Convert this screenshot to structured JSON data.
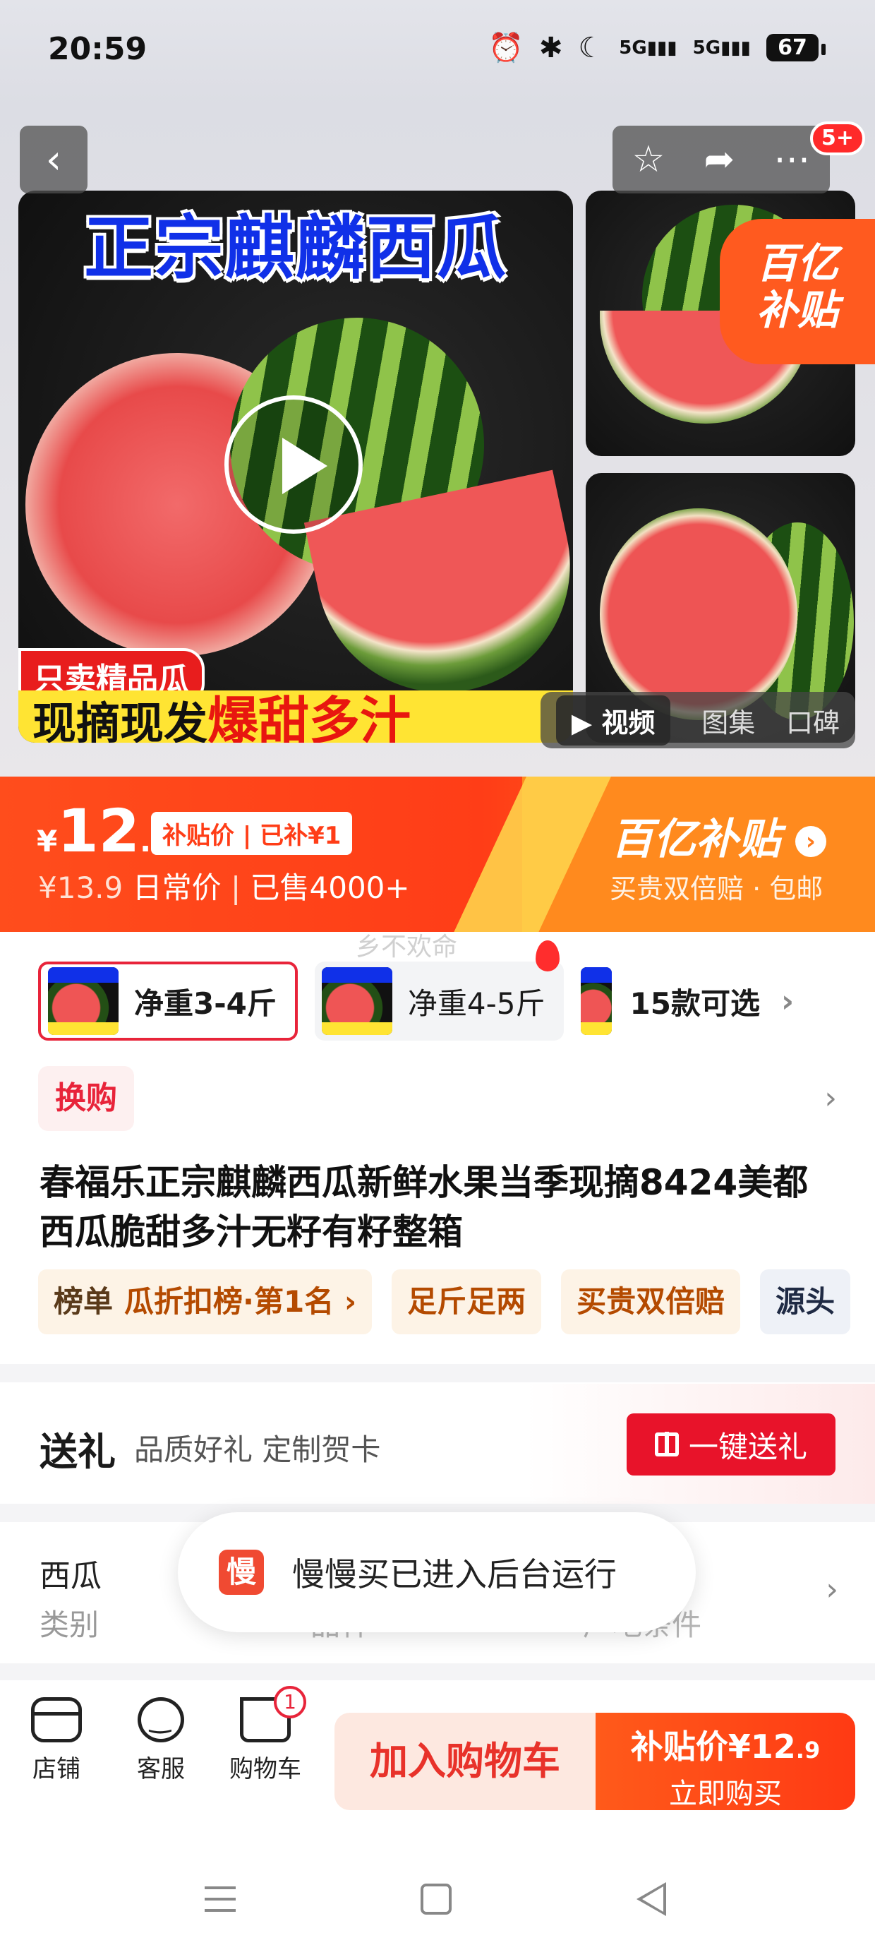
{
  "status_bar": {
    "time": "20:59",
    "network_1": "5G",
    "network_2": "5G",
    "battery": "67",
    "icons": [
      "alarm-icon",
      "bluetooth-icon",
      "moon-icon",
      "signal-icon",
      "signal-icon",
      "battery-icon"
    ]
  },
  "header": {
    "back_icon": "chevron-left-icon",
    "favorite_icon": "star-icon",
    "share_icon": "share-icon",
    "more_icon": "more-dots-icon",
    "message_badge": "5+"
  },
  "gallery": {
    "main_title": "正宗麒麟西瓜",
    "red_tag": "只卖精品瓜",
    "banner_left": "现摘现发",
    "banner_hot": "爆甜多汁",
    "corner_badge_line1": "百亿",
    "corner_badge_line2": "补贴",
    "media_tabs": [
      "视频",
      "图集",
      "口碑"
    ],
    "active_tab": "视频"
  },
  "price_banner": {
    "currency": "¥",
    "price_int": "12",
    "price_dec": ".9",
    "subsidy_tag": "补贴价 | 已补¥1",
    "original_price": "¥13.9",
    "daily_label": "日常价",
    "sold": "已售4000+",
    "brand": "百亿补贴",
    "brand_sub": "买贵双倍赔 · 包邮",
    "colors": {
      "primary": "#ff3d17",
      "accent": "#ff8a1e"
    }
  },
  "watermark": "乡不欢命",
  "sku": {
    "options": [
      {
        "label": "净重3-4斤",
        "selected": true
      },
      {
        "label": "净重4-5斤",
        "selected": false,
        "hot": true
      }
    ],
    "more_label": "15款可选"
  },
  "swap": {
    "label": "换购"
  },
  "product": {
    "title": "春福乐正宗麒麟西瓜新鲜水果当季现摘8424美都西瓜脆甜多汁无籽有籽整箱"
  },
  "tags": {
    "rank_label": "榜单",
    "rank_value": "瓜折扣榜·第1名 ›",
    "chip_1": "足斤足两",
    "chip_2": "买贵双倍赔",
    "chip_3": "源头"
  },
  "gift": {
    "title": "送礼",
    "desc": "品质好礼 定制贺卡",
    "button": "一键送礼"
  },
  "specs": {
    "value": "西瓜",
    "key": "类别",
    "faint_1": "品种",
    "faint_2": "产地条件"
  },
  "toast": {
    "logo": "慢",
    "text": "慢慢买已进入后台运行"
  },
  "bottom_bar": {
    "store": "店铺",
    "service": "客服",
    "cart": "购物车",
    "cart_count": "1",
    "add_to_cart": "加入购物车",
    "buy_price_label": "补贴价¥12",
    "buy_price_dec": ".9",
    "buy_now": "立即购买"
  }
}
